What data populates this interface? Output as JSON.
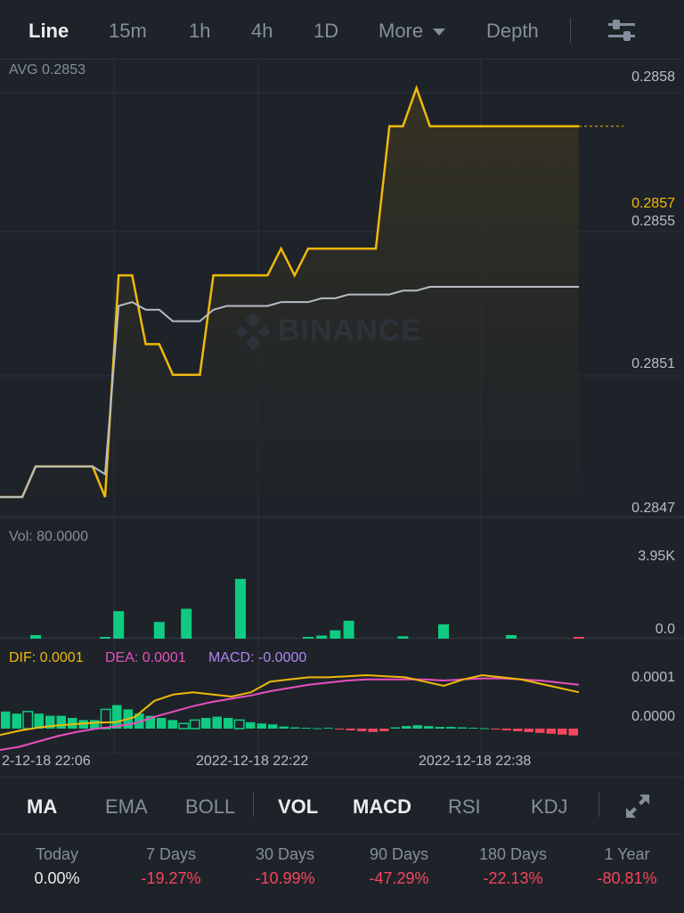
{
  "tabs": [
    {
      "label": "Line",
      "active": true
    },
    {
      "label": "15m"
    },
    {
      "label": "1h"
    },
    {
      "label": "4h"
    },
    {
      "label": "1D"
    },
    {
      "label": "More"
    },
    {
      "label": "Depth"
    }
  ],
  "main_chart": {
    "avg_label": "AVG 0.2853",
    "y_ticks": [
      "0.2858",
      "0.2855",
      "0.2851",
      "0.2847"
    ],
    "current_price": "0.2857",
    "watermark": "BINANCE"
  },
  "volume": {
    "label": "Vol: 80.0000",
    "y_ticks": [
      "3.95K",
      "0.0"
    ]
  },
  "macd": {
    "dif": "DIF: 0.0001",
    "dea": "DEA: 0.0001",
    "macd": "MACD: -0.0000",
    "y_ticks": [
      "0.0001",
      "0.0000"
    ]
  },
  "x_labels": [
    "2-12-18 22:06",
    "2022-12-18 22:22",
    "2022-12-18 22:38"
  ],
  "indicators": [
    {
      "label": "MA",
      "active": true
    },
    {
      "label": "EMA"
    },
    {
      "label": "BOLL"
    },
    {
      "label": "VOL",
      "active": true
    },
    {
      "label": "MACD",
      "active": true
    },
    {
      "label": "RSI"
    },
    {
      "label": "KDJ"
    }
  ],
  "stats": [
    {
      "label": "Today",
      "value": "0.00%"
    },
    {
      "label": "7 Days",
      "value": "-19.27%"
    },
    {
      "label": "30 Days",
      "value": "-10.99%"
    },
    {
      "label": "90 Days",
      "value": "-47.29%"
    },
    {
      "label": "180 Days",
      "value": "-22.13%"
    },
    {
      "label": "1 Year",
      "value": "-80.81%"
    }
  ],
  "colors": {
    "yellow": "#f0b90b",
    "green": "#0ecb81",
    "red": "#f6465d",
    "gray": "#b7bdc6",
    "pink": "#e94fc1",
    "purple": "#b084f0"
  },
  "chart_data": {
    "type": "line",
    "y_range": [
      0.2847,
      0.2858
    ],
    "price_series": [
      0.2847,
      0.2847,
      0.28478,
      0.28478,
      0.28478,
      0.2847,
      0.28528,
      0.28528,
      0.2851,
      0.2851,
      0.28502,
      0.28502,
      0.28502,
      0.28528,
      0.28528,
      0.28528,
      0.28528,
      0.28528,
      0.28535,
      0.28528,
      0.28535,
      0.28535,
      0.28535,
      0.28535,
      0.28535,
      0.28535,
      0.28567,
      0.28567,
      0.28577,
      0.28567,
      0.28567,
      0.28567,
      0.28567,
      0.28567,
      0.28567,
      0.28567,
      0.28567,
      0.28567,
      0.28567,
      0.28567,
      0.28567
    ],
    "avg_series": [
      0.2847,
      0.2847,
      0.28478,
      0.28478,
      0.28478,
      0.28476,
      0.2852,
      0.28521,
      0.28519,
      0.28519,
      0.28516,
      0.28516,
      0.28516,
      0.28519,
      0.2852,
      0.2852,
      0.2852,
      0.2852,
      0.28521,
      0.28521,
      0.28521,
      0.28522,
      0.28522,
      0.28523,
      0.28523,
      0.28523,
      0.28523,
      0.28524,
      0.28524,
      0.28525,
      0.28525,
      0.28525,
      0.28525,
      0.28525,
      0.28525,
      0.28525,
      0.28525,
      0.28525,
      0.28525,
      0.28525,
      0.28525
    ],
    "volume": [
      0,
      0,
      150,
      0,
      0,
      50,
      1150,
      0,
      0,
      700,
      0,
      1250,
      0,
      0,
      0,
      2500,
      0,
      0,
      0,
      0,
      40,
      130,
      350,
      750,
      0,
      0,
      0,
      100,
      0,
      0,
      600,
      0,
      0,
      0,
      0,
      150,
      0,
      0,
      0,
      0,
      50
    ],
    "volume_color": [
      "g",
      "g",
      "g",
      "g",
      "g",
      "g",
      "g",
      "g",
      "g",
      "g",
      "g",
      "g",
      "g",
      "g",
      "g",
      "g",
      "g",
      "g",
      "g",
      "g",
      "g",
      "g",
      "g",
      "g",
      "g",
      "g",
      "g",
      "g",
      "g",
      "g",
      "g",
      "g",
      "g",
      "g",
      "g",
      "g",
      "g",
      "g",
      "g",
      "g",
      "r"
    ],
    "volume_max": 3950,
    "macd_hist": [
      0.4,
      0.35,
      0.4,
      0.35,
      0.3,
      0.3,
      0.25,
      0.2,
      0.2,
      0.45,
      0.55,
      0.45,
      0.35,
      0.3,
      0.25,
      0.2,
      0.12,
      0.2,
      0.25,
      0.28,
      0.25,
      0.2,
      0.15,
      0.12,
      0.1,
      0.05,
      0.03,
      0.02,
      0.01,
      0.02,
      -0.02,
      -0.04,
      -0.06,
      -0.08,
      -0.06,
      0.03,
      0.06,
      0.08,
      0.06,
      0.04,
      0.04,
      0.03,
      0.02,
      0.01,
      -0.02,
      -0.04,
      -0.06,
      -0.08,
      -0.1,
      -0.12,
      -0.14,
      -0.16
    ],
    "dif_series": [
      -0.3,
      -0.1,
      0.05,
      0.15,
      0.22,
      0.28,
      0.3,
      0.55,
      1.3,
      1.6,
      1.7,
      1.6,
      1.5,
      1.7,
      2.2,
      2.3,
      2.4,
      2.4,
      2.45,
      2.5,
      2.45,
      2.4,
      2.2,
      2.0,
      2.3,
      2.5,
      2.4,
      2.3,
      2.1,
      1.9,
      1.7
    ],
    "dea_series": [
      -1.0,
      -0.85,
      -0.6,
      -0.35,
      -0.15,
      0.0,
      0.1,
      0.25,
      0.55,
      0.8,
      1.05,
      1.25,
      1.4,
      1.55,
      1.75,
      1.9,
      2.05,
      2.15,
      2.25,
      2.3,
      2.3,
      2.3,
      2.3,
      2.25,
      2.3,
      2.35,
      2.35,
      2.3,
      2.25,
      2.15,
      2.05
    ]
  }
}
